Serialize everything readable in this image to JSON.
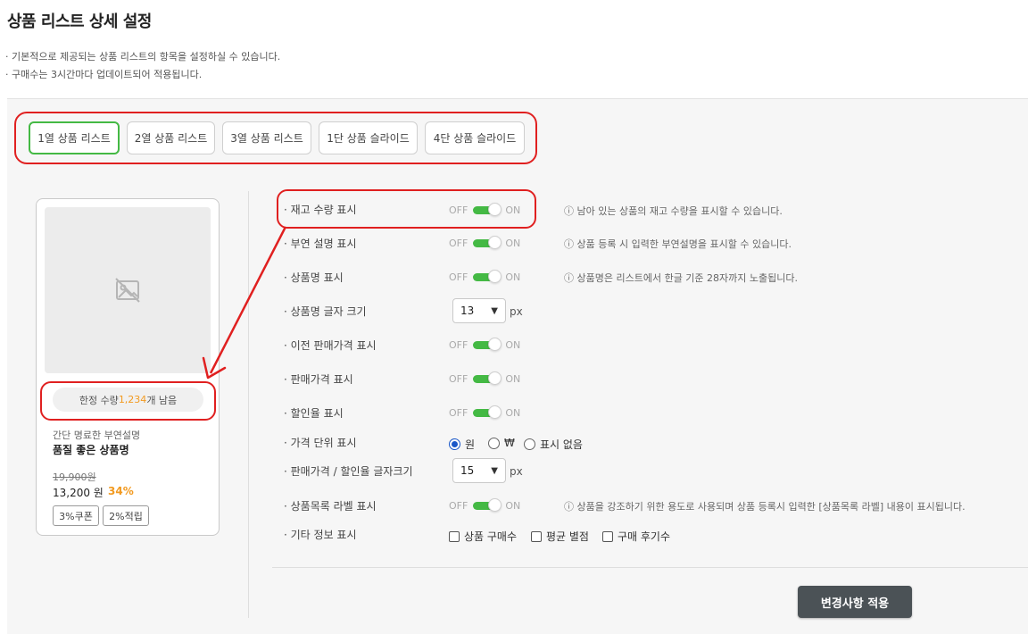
{
  "page_title": "상품 리스트 상세 설정",
  "descriptions": [
    "· 기본적으로 제공되는 상품 리스트의 항목을 설정하실 수 있습니다.",
    "· 구매수는 3시간마다 업데이트되어 적용됩니다."
  ],
  "tabs": [
    {
      "label": "1열 상품 리스트",
      "active": true
    },
    {
      "label": "2열 상품 리스트",
      "active": false
    },
    {
      "label": "3열 상품 리스트",
      "active": false
    },
    {
      "label": "1단 상품 슬라이드",
      "active": false
    },
    {
      "label": "4단 상품 슬라이드",
      "active": false
    }
  ],
  "preview": {
    "stock_prefix": "한정 수량 ",
    "stock_number": "1,234",
    "stock_suffix": "개 남음",
    "sub_description": "간단 명료한 부연설명",
    "product_name": "품질 좋은 상품명",
    "original_price": "19,900원",
    "sale_price": "13,200 원",
    "discount": "34%",
    "badges": [
      "3%쿠폰",
      "2%적립"
    ]
  },
  "settings": {
    "stock": {
      "label": "· 재고 수량 표시",
      "off": "OFF",
      "on": "ON",
      "hint": "ⓘ 남아 있는 상품의 재고 수량을 표시할 수 있습니다."
    },
    "sub_desc": {
      "label": "· 부연 설명 표시",
      "off": "OFF",
      "on": "ON",
      "hint": "ⓘ 상품 등록 시 입력한 부연설명을 표시할 수 있습니다."
    },
    "name": {
      "label": "· 상품명 표시",
      "off": "OFF",
      "on": "ON",
      "hint": "ⓘ 상품명은 리스트에서 한글 기준 28자까지 노출됩니다."
    },
    "name_size": {
      "label": "· 상품명 글자 크기",
      "value": "13",
      "unit": "px"
    },
    "prev_price": {
      "label": "· 이전 판매가격 표시",
      "off": "OFF",
      "on": "ON"
    },
    "price": {
      "label": "· 판매가격 표시",
      "off": "OFF",
      "on": "ON"
    },
    "discount": {
      "label": "· 할인율 표시",
      "off": "OFF",
      "on": "ON"
    },
    "currency": {
      "label": "· 가격 단위 표시",
      "options": [
        "원",
        "₩",
        "표시 없음"
      ],
      "selected": "원"
    },
    "price_size": {
      "label": "· 판매가격 / 할인율 글자크기",
      "value": "15",
      "unit": "px"
    },
    "list_label": {
      "label": "· 상품목록 라벨 표시",
      "off": "OFF",
      "on": "ON",
      "hint": "ⓘ 상품을 강조하기 위한 용도로 사용되며 상품 등록시 입력한 [상품목록 라벨] 내용이 표시됩니다."
    },
    "etc": {
      "label": "· 기타 정보 표시",
      "options": [
        "상품 구매수",
        "평균 별점",
        "구매 후기수"
      ]
    }
  },
  "apply_button": "변경사항 적용",
  "colors": {
    "accent_green": "#44b944",
    "highlight_red": "#e02020",
    "discount_orange": "#f29a20",
    "button_dark": "#4b5256"
  }
}
